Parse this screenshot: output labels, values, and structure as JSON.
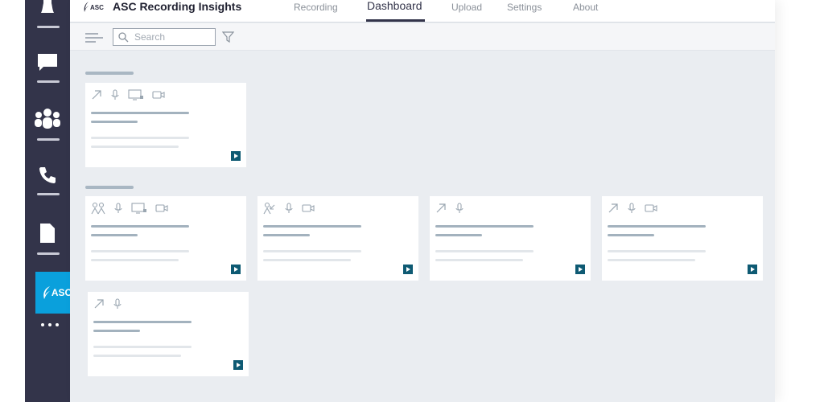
{
  "app": {
    "title": "ASC Recording Insights",
    "logo_text": "ASC"
  },
  "rail": {
    "asc_label": "ASC",
    "items": [
      {
        "name": "activity-icon"
      },
      {
        "name": "chat-icon"
      },
      {
        "name": "teams-icon"
      },
      {
        "name": "calls-icon"
      },
      {
        "name": "files-icon"
      }
    ]
  },
  "tabs": [
    {
      "label": "Recording",
      "active": false
    },
    {
      "label": "Dashboard",
      "active": true
    },
    {
      "label": "Upload",
      "active": false
    },
    {
      "label": "Settings",
      "active": false
    },
    {
      "label": "About",
      "active": false
    }
  ],
  "search": {
    "placeholder": "Search"
  },
  "colors": {
    "rail": "#33344a",
    "accent": "#0aa0dc",
    "play": "#0e5a73"
  }
}
